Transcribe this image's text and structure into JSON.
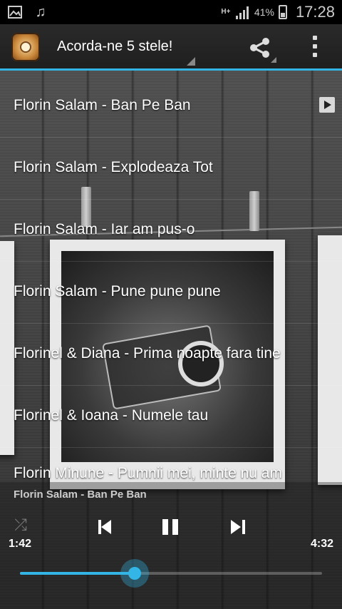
{
  "status_bar": {
    "network": "H+",
    "battery_percent": "41%",
    "time": "17:28",
    "icons": [
      "image-icon",
      "music-note-icon",
      "signal-icon",
      "battery-icon"
    ]
  },
  "action_bar": {
    "title": "Acorda-ne 5 stele!",
    "icons": [
      "app-icon",
      "share-icon",
      "overflow-menu-icon"
    ]
  },
  "songs": [
    {
      "label": "Florin Salam - Ban Pe Ban",
      "playing": true
    },
    {
      "label": "Florin Salam - Explodeaza Tot"
    },
    {
      "label": "Florin Salam - Iar am pus-o"
    },
    {
      "label": "Florin Salam - Pune pune pune"
    },
    {
      "label": "Florinel & Diana - Prima noapte fara tine"
    },
    {
      "label": "Florinel & Ioana - Numele tau"
    },
    {
      "label": "Florin Minune - Pumnii mei, minte nu am"
    }
  ],
  "player": {
    "now_playing": "Florin Salam - Ban Pe Ban",
    "current_time": "1:42",
    "total_time": "4:32",
    "progress": 0.38,
    "accent_color": "#33b5e5",
    "controls": [
      "shuffle-icon",
      "previous-icon",
      "pause-icon",
      "next-icon"
    ]
  }
}
